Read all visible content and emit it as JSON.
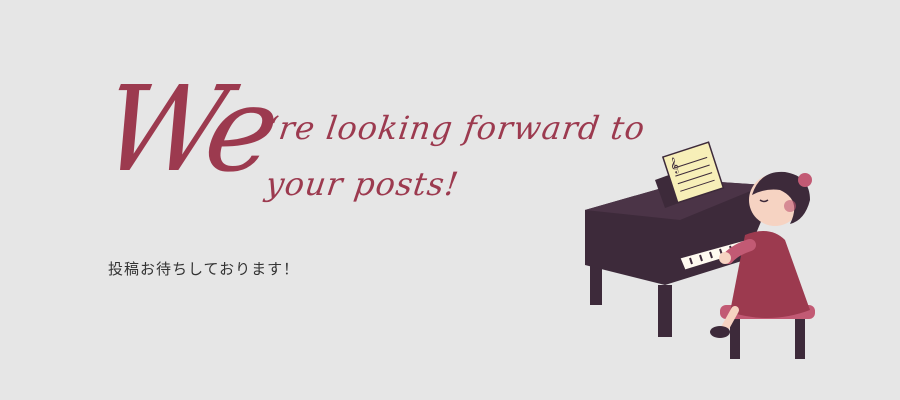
{
  "headline": {
    "big": "We",
    "line1": "‘re looking forward to",
    "line2": "your posts!"
  },
  "subtitle": "投稿お待ちしております！",
  "illustration": {
    "icon": "girl-playing-piano-icon"
  },
  "colors": {
    "background": "#e6e6e6",
    "accent": "#9c3a4f",
    "text": "#333333",
    "piano": "#3d2a3a"
  }
}
